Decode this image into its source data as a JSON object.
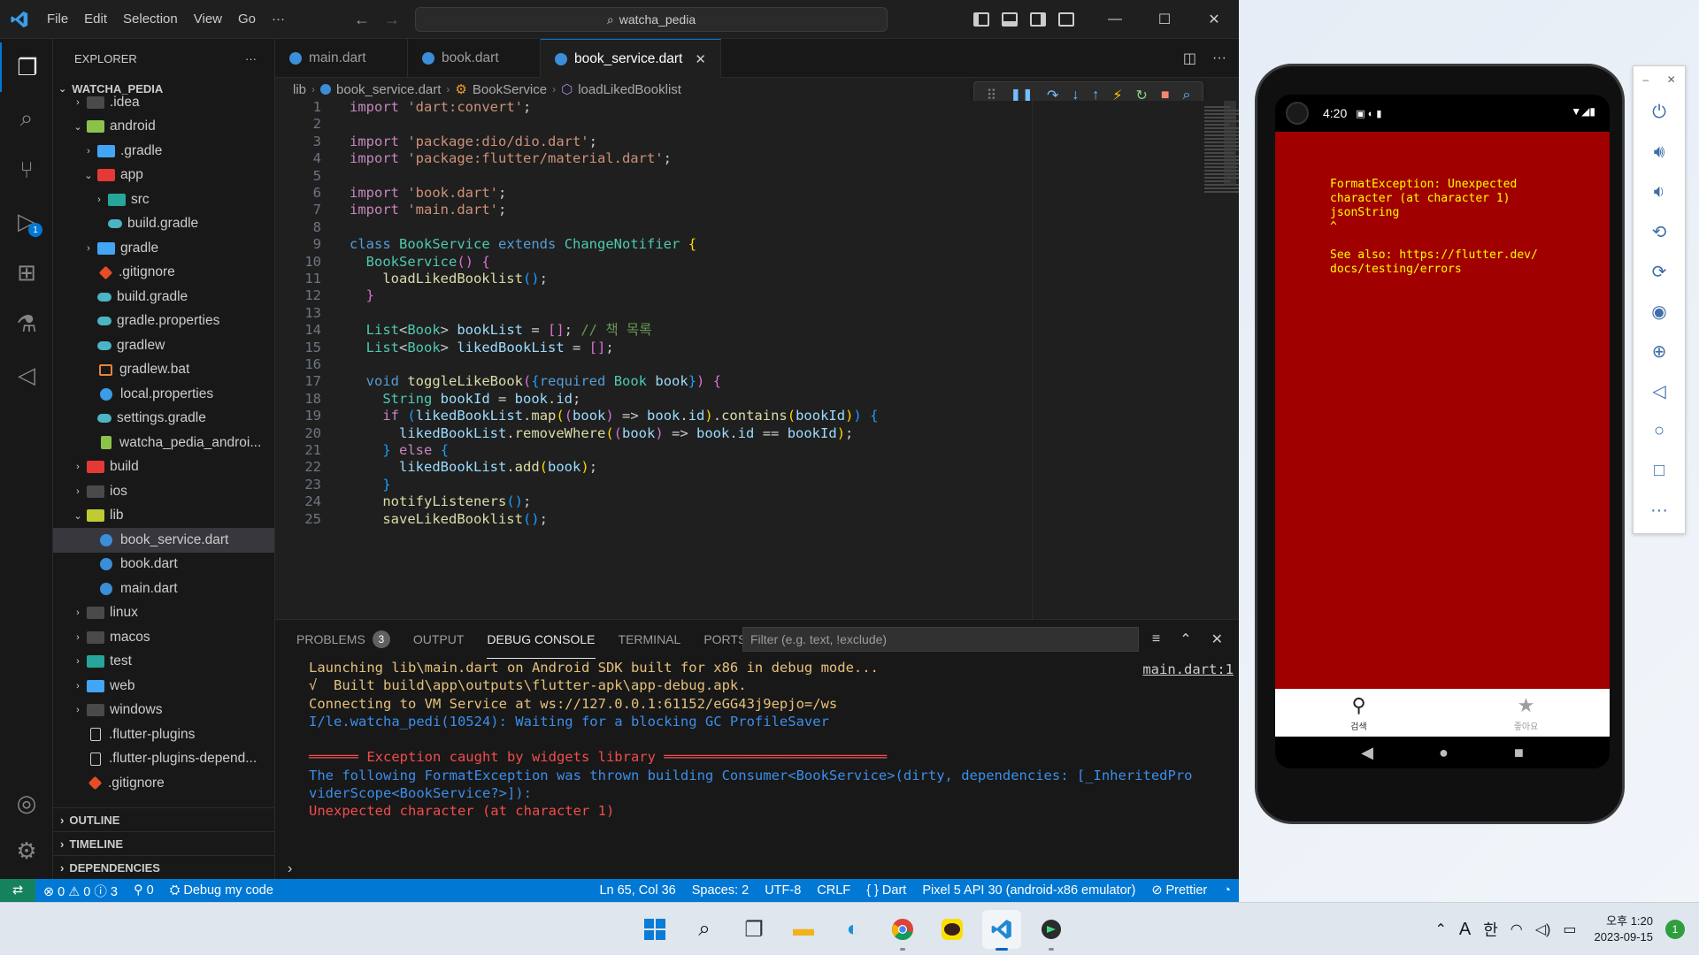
{
  "window": {
    "menu": [
      "File",
      "Edit",
      "Selection",
      "View",
      "Go",
      "···"
    ],
    "command_center": "watcha_pedia",
    "controls": [
      "—",
      "☐",
      "✕"
    ]
  },
  "activity": {
    "debug_badge": "1"
  },
  "sidebar": {
    "title": "EXPLORER",
    "more": "···",
    "root": "WATCHA_PEDIA",
    "items": [
      {
        "label": ".idea",
        "depth": 1,
        "chev": "›",
        "icon": "folder"
      },
      {
        "label": "android",
        "depth": 1,
        "chev": "⌄",
        "icon": "folder-android"
      },
      {
        "label": ".gradle",
        "depth": 2,
        "chev": "›",
        "icon": "folder-blue"
      },
      {
        "label": "app",
        "depth": 2,
        "chev": "⌄",
        "icon": "folder-red"
      },
      {
        "label": "src",
        "depth": 3,
        "chev": "›",
        "icon": "folder-teal"
      },
      {
        "label": "build.gradle",
        "depth": 3,
        "chev": "",
        "icon": "gradle"
      },
      {
        "label": "gradle",
        "depth": 2,
        "chev": "›",
        "icon": "folder-blue"
      },
      {
        "label": ".gitignore",
        "depth": 2,
        "chev": "",
        "icon": "git"
      },
      {
        "label": "build.gradle",
        "depth": 2,
        "chev": "",
        "icon": "gradle"
      },
      {
        "label": "gradle.properties",
        "depth": 2,
        "chev": "",
        "icon": "gradle"
      },
      {
        "label": "gradlew",
        "depth": 2,
        "chev": "",
        "icon": "gradle"
      },
      {
        "label": "gradlew.bat",
        "depth": 2,
        "chev": "",
        "icon": "bat"
      },
      {
        "label": "local.properties",
        "depth": 2,
        "chev": "",
        "icon": "gear"
      },
      {
        "label": "settings.gradle",
        "depth": 2,
        "chev": "",
        "icon": "gradle"
      },
      {
        "label": "watcha_pedia_androi...",
        "depth": 2,
        "chev": "",
        "icon": "xml"
      },
      {
        "label": "build",
        "depth": 1,
        "chev": "›",
        "icon": "folder-red"
      },
      {
        "label": "ios",
        "depth": 1,
        "chev": "›",
        "icon": "folder"
      },
      {
        "label": "lib",
        "depth": 1,
        "chev": "⌄",
        "icon": "folder-yellow"
      },
      {
        "label": "book_service.dart",
        "depth": 2,
        "chev": "",
        "icon": "dart",
        "selected": true
      },
      {
        "label": "book.dart",
        "depth": 2,
        "chev": "",
        "icon": "dart"
      },
      {
        "label": "main.dart",
        "depth": 2,
        "chev": "",
        "icon": "dart"
      },
      {
        "label": "linux",
        "depth": 1,
        "chev": "›",
        "icon": "folder"
      },
      {
        "label": "macos",
        "depth": 1,
        "chev": "›",
        "icon": "folder"
      },
      {
        "label": "test",
        "depth": 1,
        "chev": "›",
        "icon": "folder-teal"
      },
      {
        "label": "web",
        "depth": 1,
        "chev": "›",
        "icon": "folder-blue"
      },
      {
        "label": "windows",
        "depth": 1,
        "chev": "›",
        "icon": "folder"
      },
      {
        "label": ".flutter-plugins",
        "depth": 1,
        "chev": "",
        "icon": "doc"
      },
      {
        "label": ".flutter-plugins-depend...",
        "depth": 1,
        "chev": "",
        "icon": "doc"
      },
      {
        "label": ".gitignore",
        "depth": 1,
        "chev": "",
        "icon": "git"
      }
    ],
    "sections": [
      "OUTLINE",
      "TIMELINE",
      "DEPENDENCIES"
    ]
  },
  "tabs": [
    {
      "label": "main.dart",
      "active": false
    },
    {
      "label": "book.dart",
      "active": false
    },
    {
      "label": "book_service.dart",
      "active": true
    }
  ],
  "breadcrumb": [
    "lib",
    "book_service.dart",
    "BookService",
    "loadLikedBooklist"
  ],
  "editor": {
    "lines": [
      {
        "n": "1",
        "html": "<span class='ctl'>import</span> <span class='str'>'dart:convert'</span>;"
      },
      {
        "n": "2",
        "html": ""
      },
      {
        "n": "3",
        "html": "<span class='ctl'>import</span> <span class='str'>'package:dio/dio.dart'</span>;"
      },
      {
        "n": "4",
        "html": "<span class='ctl'>import</span> <span class='str'>'package:flutter/material.dart'</span>;"
      },
      {
        "n": "5",
        "html": ""
      },
      {
        "n": "6",
        "html": "<span class='ctl'>import</span> <span class='str'>'book.dart'</span>;"
      },
      {
        "n": "7",
        "html": "<span class='ctl'>import</span> <span class='str'>'main.dart'</span>;"
      },
      {
        "n": "8",
        "html": ""
      },
      {
        "n": "9",
        "html": "<span class='kw'>class</span> <span class='cls'>BookService</span> <span class='kw'>extends</span> <span class='cls'>ChangeNotifier</span> <span class='br1'>{</span>"
      },
      {
        "n": "10",
        "html": "  <span class='cls'>BookService</span><span class='br2'>()</span> <span class='br2'>{</span>"
      },
      {
        "n": "11",
        "html": "    <span class='fn'>loadLikedBooklist</span><span class='br3'>()</span>;"
      },
      {
        "n": "12",
        "html": "  <span class='br2'>}</span>"
      },
      {
        "n": "13",
        "html": ""
      },
      {
        "n": "14",
        "html": "  <span class='cls'>List</span>&lt;<span class='cls'>Book</span>&gt; <span class='var'>bookList</span> = <span class='br2'>[]</span>; <span class='cmt'>// 책 목록</span>"
      },
      {
        "n": "15",
        "html": "  <span class='cls'>List</span>&lt;<span class='cls'>Book</span>&gt; <span class='var'>likedBookList</span> = <span class='br2'>[]</span>;"
      },
      {
        "n": "16",
        "html": ""
      },
      {
        "n": "17",
        "html": "  <span class='kw'>void</span> <span class='fn'>toggleLikeBook</span><span class='br2'>(</span><span class='br3'>{</span><span class='kw'>required</span> <span class='cls'>Book</span> <span class='var'>book</span><span class='br3'>}</span><span class='br2'>)</span> <span class='br2'>{</span>"
      },
      {
        "n": "18",
        "html": "    <span class='cls'>String</span> <span class='var'>bookId</span> = <span class='var'>book</span>.<span class='var'>id</span>;"
      },
      {
        "n": "19",
        "html": "    <span class='ctl'>if</span> <span class='br3'>(</span><span class='var'>likedBookList</span>.<span class='fn'>map</span><span class='br1'>(</span><span class='br2'>(</span><span class='var'>book</span><span class='br2'>)</span> =&gt; <span class='var'>book</span>.<span class='var'>id</span><span class='br1'>)</span>.<span class='fn'>contains</span><span class='br1'>(</span><span class='var'>bookId</span><span class='br1'>)</span><span class='br3'>)</span> <span class='br3'>{</span>"
      },
      {
        "n": "20",
        "html": "      <span class='var'>likedBookList</span>.<span class='fn'>removeWhere</span><span class='br1'>(</span><span class='br2'>(</span><span class='var'>book</span><span class='br2'>)</span> =&gt; <span class='var'>book</span>.<span class='var'>id</span> == <span class='var'>bookId</span><span class='br1'>)</span>;"
      },
      {
        "n": "21",
        "html": "    <span class='br3'>}</span> <span class='ctl'>else</span> <span class='br3'>{</span>"
      },
      {
        "n": "22",
        "html": "      <span class='var'>likedBookList</span>.<span class='fn'>add</span><span class='br1'>(</span><span class='var'>book</span><span class='br1'>)</span>;"
      },
      {
        "n": "23",
        "html": "    <span class='br3'>}</span>"
      },
      {
        "n": "24",
        "html": "    <span class='fn'>notifyListeners</span><span class='br3'>()</span>;"
      },
      {
        "n": "25",
        "html": "    <span class='fn'>saveLikedBooklist</span><span class='br3'>()</span>;"
      }
    ]
  },
  "panel": {
    "tabs": [
      {
        "label": "PROBLEMS",
        "count": "3"
      },
      {
        "label": "OUTPUT"
      },
      {
        "label": "DEBUG CONSOLE",
        "active": true
      },
      {
        "label": "TERMINAL"
      },
      {
        "label": "PORTS"
      }
    ],
    "filter_placeholder": "Filter (e.g. text, !exclude)",
    "link": "main.dart:1",
    "console": [
      {
        "text": "Launching lib\\main.dart on Android SDK built for x86 in debug mode...",
        "color": "c-yellow"
      },
      {
        "text": "√  Built build\\app\\outputs\\flutter-apk\\app-debug.apk.",
        "color": "c-yellow"
      },
      {
        "text": "Connecting to VM Service at ws://127.0.0.1:61152/eGG43j9epjo=/ws",
        "color": "c-yellow"
      },
      {
        "text": "I/le.watcha_pedi(10524): Waiting for a blocking GC ProfileSaver",
        "color": "c-blue"
      },
      {
        "text": "",
        "color": "c-blue"
      },
      {
        "text": "══════ Exception caught by widgets library ═══════════════════════════",
        "color": "c-red"
      },
      {
        "text": "The following FormatException was thrown building Consumer<BookService>(dirty, dependencies: [_InheritedPro",
        "color": "c-blue"
      },
      {
        "text": "viderScope<BookService?>]):",
        "color": "c-blue"
      },
      {
        "text": "Unexpected character (at character 1)",
        "color": "c-red"
      }
    ],
    "prompt": "›"
  },
  "statusbar": {
    "remote": "⇄",
    "problems": "⊗ 0 ⚠ 0 ⓘ 3",
    "ports": "⚲ 0",
    "debug": "Debug my code",
    "position": "Ln 65, Col 36",
    "spaces": "Spaces: 2",
    "encoding": "UTF-8",
    "eol": "CRLF",
    "language": "{ } Dart",
    "device": "Pixel 5 API 30 (android-x86 emulator)",
    "prettier": "⊘ Prettier",
    "bell": "🔔"
  },
  "phone": {
    "time": "4:20",
    "error": "FormatException: Unexpected\ncharacter (at character 1)\njsonString\n^\n\nSee also: https://flutter.dev/\ndocs/testing/errors",
    "nav": [
      {
        "label": "검색",
        "icon": "search-icon",
        "glyph": "⌕"
      },
      {
        "label": "좋아요",
        "icon": "star-icon",
        "glyph": "★"
      }
    ]
  },
  "emulator_toolbar": {
    "buttons": [
      "power",
      "volume-up",
      "volume-down",
      "rotate-left",
      "rotate-right",
      "camera",
      "zoom",
      "back",
      "home",
      "overview",
      "more"
    ]
  },
  "taskbar": {
    "tray": {
      "input": "A",
      "ime": "한",
      "time": "오후 1:20",
      "date": "2023-09-15",
      "notif": "1"
    }
  }
}
